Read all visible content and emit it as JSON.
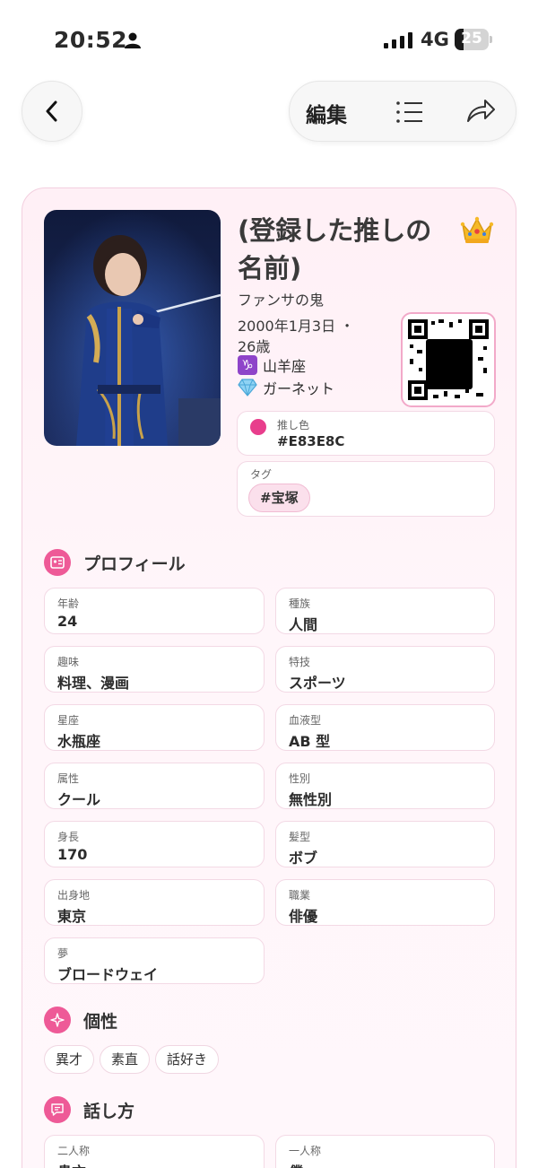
{
  "status_bar": {
    "time": "20:52",
    "network": "4G",
    "battery_level": "25",
    "battery_fraction": 0.25
  },
  "nav": {
    "edit_label": "編集"
  },
  "oshi": {
    "name": "(登録した推しの名前)",
    "subtitle": "ファンサの鬼",
    "birth_line1": "2000年1月3日 ・",
    "birth_line2": "26歳",
    "zodiac": "山羊座",
    "zodiac_symbol": "♑",
    "birthstone": "ガーネット",
    "color_label": "推し色",
    "color_value": "#E83E8C",
    "tag_label": "タグ",
    "tag": "#宝塚"
  },
  "profile": {
    "title": "プロフィール",
    "fields": [
      {
        "label": "年齢",
        "value": "24"
      },
      {
        "label": "種族",
        "value": "人間"
      },
      {
        "label": "趣味",
        "value": "料理、漫画"
      },
      {
        "label": "特技",
        "value": "スポーツ"
      },
      {
        "label": "星座",
        "value": "水瓶座"
      },
      {
        "label": "血液型",
        "value": "AB 型"
      },
      {
        "label": "属性",
        "value": "クール"
      },
      {
        "label": "性別",
        "value": "無性別"
      },
      {
        "label": "身長",
        "value": "170"
      },
      {
        "label": "髪型",
        "value": "ボブ"
      },
      {
        "label": "出身地",
        "value": "東京"
      },
      {
        "label": "職業",
        "value": "俳優"
      },
      {
        "label": "夢",
        "value": "ブロードウェイ"
      }
    ]
  },
  "personality": {
    "title": "個性",
    "tags": [
      "異才",
      "素直",
      "話好き"
    ]
  },
  "speech": {
    "title": "話し方",
    "fields": [
      {
        "label": "二人称",
        "value": "貴方"
      },
      {
        "label": "一人称",
        "value": "僕"
      }
    ]
  },
  "colors": {
    "accent": "#E83E8C",
    "section_icon": "#EE5A97"
  }
}
